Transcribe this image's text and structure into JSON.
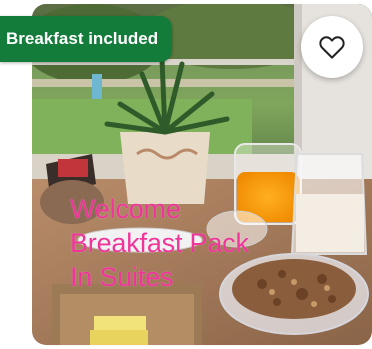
{
  "badge": {
    "label": "Breakfast included",
    "color": "#137c3a"
  },
  "favorite": {
    "icon": "heart-outline-icon"
  },
  "photo": {
    "overlay_lines": [
      "Welcome",
      "Breakfast Pack",
      "In Suites"
    ],
    "overlay_color": "#f0359a"
  }
}
